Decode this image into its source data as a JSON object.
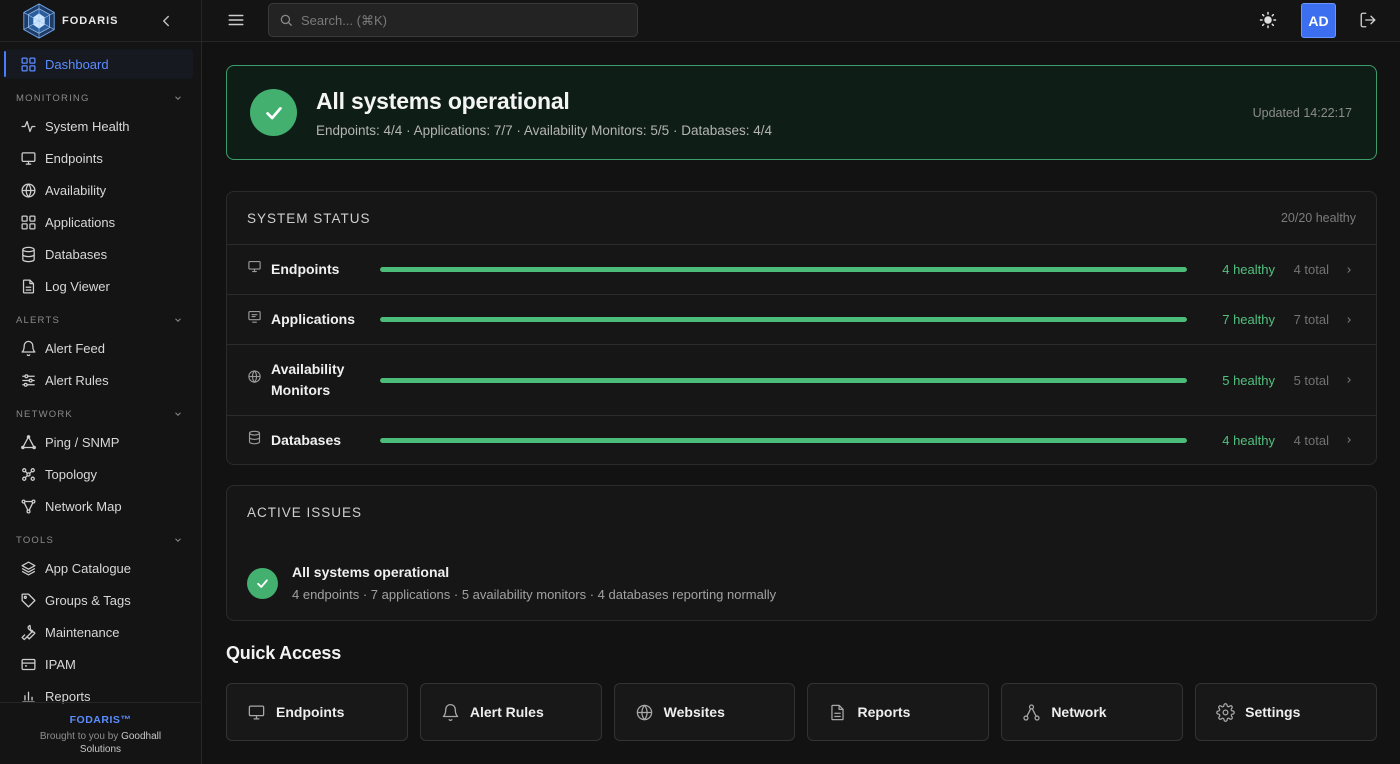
{
  "brand": {
    "name": "FODARIS"
  },
  "sidebar": {
    "dashboard": {
      "label": "Dashboard",
      "icon": "dashboard-grid-icon"
    },
    "sections": [
      {
        "title": "MONITORING",
        "items": [
          {
            "label": "System Health",
            "icon": "pulse-icon"
          },
          {
            "label": "Endpoints",
            "icon": "monitor-icon"
          },
          {
            "label": "Availability",
            "icon": "globe-icon"
          },
          {
            "label": "Applications",
            "icon": "apps-grid-icon"
          },
          {
            "label": "Databases",
            "icon": "database-icon"
          },
          {
            "label": "Log Viewer",
            "icon": "file-text-icon"
          }
        ]
      },
      {
        "title": "ALERTS",
        "items": [
          {
            "label": "Alert Feed",
            "icon": "bell-icon"
          },
          {
            "label": "Alert Rules",
            "icon": "sliders-icon"
          }
        ]
      },
      {
        "title": "NETWORK",
        "items": [
          {
            "label": "Ping / SNMP",
            "icon": "triangle-nodes-icon"
          },
          {
            "label": "Topology",
            "icon": "topology-icon"
          },
          {
            "label": "Network Map",
            "icon": "branch-icon"
          }
        ]
      },
      {
        "title": "TOOLS",
        "items": [
          {
            "label": "App Catalogue",
            "icon": "layers-icon"
          },
          {
            "label": "Groups & Tags",
            "icon": "tag-icon"
          },
          {
            "label": "Maintenance",
            "icon": "wrench-icon"
          },
          {
            "label": "IPAM",
            "icon": "ipam-card-icon"
          },
          {
            "label": "Reports",
            "icon": "bar-chart-icon"
          }
        ]
      }
    ],
    "footer": {
      "brand": "FODARIS™",
      "credit_prefix": "Brought to you by",
      "credit_name": "Goodhall Solutions"
    }
  },
  "topbar": {
    "search_placeholder": "Search... (⌘K)",
    "avatar_initials": "AD"
  },
  "banner": {
    "title": "All systems operational",
    "subtitle": "Endpoints: 4/4 · Applications: 7/7 · Availability Monitors: 5/5 · Databases: 4/4",
    "updated": "Updated 14:22:17"
  },
  "system_status": {
    "title": "SYSTEM STATUS",
    "summary": "20/20 healthy",
    "rows": [
      {
        "label": "Endpoints",
        "icon": "monitor-icon",
        "healthy": "4 healthy",
        "total": "4 total",
        "fraction": 1.0
      },
      {
        "label": "Applications",
        "icon": "app-window-icon",
        "healthy": "7 healthy",
        "total": "7 total",
        "fraction": 1.0
      },
      {
        "label": "Availability Monitors",
        "icon": "globe-icon",
        "healthy": "5 healthy",
        "total": "5 total",
        "fraction": 1.0
      },
      {
        "label": "Databases",
        "icon": "database-icon",
        "healthy": "4 healthy",
        "total": "4 total",
        "fraction": 1.0
      }
    ]
  },
  "active_issues": {
    "title": "ACTIVE ISSUES",
    "item_title": "All systems operational",
    "item_sub": "4 endpoints · 7 applications · 5 availability monitors · 4 databases reporting normally"
  },
  "quick_access": {
    "title": "Quick Access",
    "items": [
      {
        "label": "Endpoints",
        "icon": "monitor-icon"
      },
      {
        "label": "Alert Rules",
        "icon": "bell-icon"
      },
      {
        "label": "Websites",
        "icon": "globe-icon"
      },
      {
        "label": "Reports",
        "icon": "file-text-icon"
      },
      {
        "label": "Network",
        "icon": "network-nodes-icon"
      },
      {
        "label": "Settings",
        "icon": "gear-icon"
      }
    ]
  },
  "colors": {
    "accent": "#4a7dff",
    "success": "#43b06f",
    "background": "#121212"
  }
}
